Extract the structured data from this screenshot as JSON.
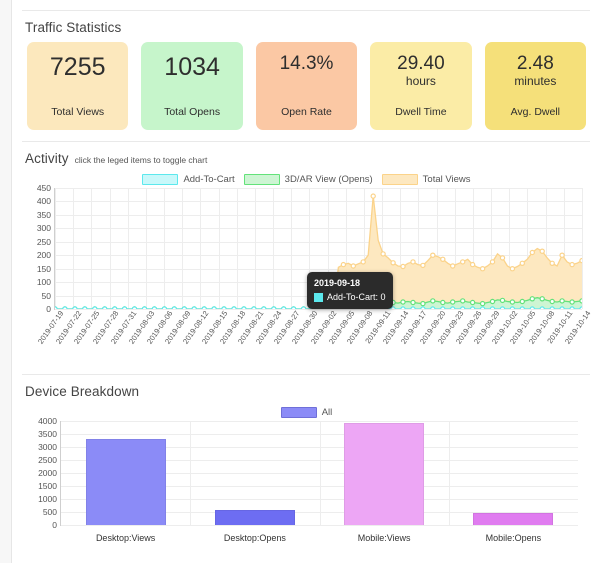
{
  "traffic": {
    "title": "Traffic Statistics",
    "cards": [
      {
        "value": "7255",
        "unit": "",
        "label": "Total Views",
        "color": "#fce8bd",
        "size": "lg"
      },
      {
        "value": "1034",
        "unit": "",
        "label": "Total Opens",
        "color": "#c6f5cb",
        "size": "lg"
      },
      {
        "value": "14.3%",
        "unit": "",
        "label": "Open Rate",
        "color": "#fbc8a4",
        "size": "sm"
      },
      {
        "value": "29.40",
        "unit": "hours",
        "label": "Dwell Time",
        "color": "#fbeca6",
        "size": "sm"
      },
      {
        "value": "2.48",
        "unit": "minutes",
        "label": "Avg. Dwell",
        "color": "#f5e07a",
        "size": "sm"
      }
    ]
  },
  "activity": {
    "title": "Activity",
    "subtitle": "click the leged items to toggle chart",
    "tooltip": {
      "date": "2019-09-18",
      "series_label": "Add-To-Cart",
      "value": "0",
      "row_text": "Add-To-Cart: 0",
      "swatch_color": "#5ce8ed"
    },
    "chart_data": {
      "type": "area",
      "title": "Activity",
      "xlabel": "",
      "ylabel": "",
      "ylim": [
        0,
        450
      ],
      "yticks": [
        0,
        50,
        100,
        150,
        200,
        250,
        300,
        350,
        400,
        450
      ],
      "grid": true,
      "legend_position": "top-center",
      "x": [
        "2019-07-19",
        "2019-07-22",
        "2019-07-25",
        "2019-07-28",
        "2019-07-31",
        "2019-08-03",
        "2019-08-06",
        "2019-08-09",
        "2019-08-12",
        "2019-08-15",
        "2019-08-18",
        "2019-08-21",
        "2019-08-24",
        "2019-08-27",
        "2019-08-30",
        "2019-09-02",
        "2019-09-05",
        "2019-09-08",
        "2019-09-11",
        "2019-09-14",
        "2019-09-17",
        "2019-09-20",
        "2019-09-23",
        "2019-09-26",
        "2019-09-29",
        "2019-10-02",
        "2019-10-05",
        "2019-10-08",
        "2019-10-11",
        "2019-10-14"
      ],
      "series": [
        {
          "name": "Total Views",
          "color": "#fbd38a",
          "fill": "#fde8c0",
          "values": [
            0,
            0,
            0,
            0,
            0,
            0,
            0,
            0,
            0,
            0,
            0,
            0,
            0,
            0,
            0,
            0,
            0,
            0,
            0,
            0,
            0,
            0,
            0,
            0,
            0,
            0,
            0,
            0,
            0,
            0,
            0,
            0,
            0,
            0,
            0,
            0,
            0,
            0,
            0,
            0,
            0,
            0,
            0,
            0,
            0,
            0,
            0,
            0,
            0,
            0,
            0,
            0,
            0,
            0,
            0,
            0,
            0,
            155,
            165,
            170,
            160,
            168,
            175,
            200,
            420,
            255,
            205,
            190,
            172,
            160,
            158,
            170,
            175,
            165,
            162,
            180,
            200,
            195,
            185,
            170,
            160,
            168,
            175,
            185,
            165,
            155,
            150,
            160,
            175,
            205,
            190,
            160,
            150,
            158,
            170,
            185,
            210,
            225,
            215,
            190,
            170,
            160,
            200,
            175,
            165,
            170,
            180
          ]
        },
        {
          "name": "3D/AR View (Opens)",
          "color": "#63e27a",
          "fill": "#cdf5d3",
          "values": [
            0,
            0,
            0,
            0,
            0,
            0,
            0,
            0,
            0,
            0,
            0,
            0,
            0,
            0,
            0,
            0,
            0,
            0,
            0,
            0,
            0,
            0,
            0,
            0,
            0,
            0,
            0,
            0,
            0,
            0,
            0,
            0,
            0,
            0,
            0,
            0,
            0,
            0,
            0,
            0,
            0,
            0,
            0,
            0,
            0,
            0,
            0,
            0,
            0,
            0,
            0,
            0,
            0,
            0,
            0,
            0,
            0,
            18,
            22,
            20,
            24,
            22,
            26,
            24,
            30,
            26,
            22,
            25,
            24,
            22,
            26,
            28,
            24,
            22,
            20,
            26,
            30,
            28,
            24,
            22,
            26,
            28,
            30,
            26,
            24,
            22,
            20,
            24,
            28,
            34,
            32,
            28,
            26,
            24,
            28,
            32,
            38,
            42,
            38,
            32,
            28,
            26,
            30,
            28,
            26,
            28,
            30
          ]
        },
        {
          "name": "Add-To-Cart",
          "color": "#5ce8ed",
          "fill": "#c8f8fa",
          "values": [
            0,
            0,
            0,
            0,
            0,
            0,
            0,
            0,
            0,
            0,
            0,
            0,
            0,
            0,
            0,
            0,
            0,
            0,
            0,
            0,
            0,
            0,
            0,
            0,
            0,
            0,
            0,
            0,
            0,
            0,
            0,
            0,
            0,
            0,
            0,
            0,
            0,
            0,
            0,
            0,
            0,
            0,
            0,
            0,
            0,
            0,
            0,
            0,
            0,
            0,
            0,
            0,
            0,
            0,
            0,
            0,
            0,
            0,
            0,
            0,
            0,
            0,
            0,
            0,
            0,
            0,
            0,
            0,
            0,
            0,
            0,
            0,
            0,
            0,
            0,
            0,
            0,
            0,
            0,
            0,
            0,
            0,
            0,
            0,
            0,
            0,
            0,
            0,
            0,
            0,
            0,
            0,
            0,
            0,
            0,
            0,
            0,
            0,
            0,
            0,
            0,
            0,
            0,
            0,
            0,
            0,
            0
          ]
        }
      ],
      "legend": [
        {
          "name": "Add-To-Cart",
          "swatch": "#c8f8fa",
          "border": "#5ce8ed"
        },
        {
          "name": "3D/AR View (Opens)",
          "swatch": "#cdf5d3",
          "border": "#63e27a"
        },
        {
          "name": "Total Views",
          "swatch": "#fde8c0",
          "border": "#fbd38a"
        }
      ]
    }
  },
  "device": {
    "title": "Device Breakdown",
    "legend": [
      {
        "name": "All",
        "swatch": "#8b8bf7",
        "border": "#6f6fd8"
      }
    ],
    "chart_data": {
      "type": "bar",
      "title": "Device Breakdown",
      "xlabel": "",
      "ylabel": "",
      "ylim": [
        0,
        4000
      ],
      "yticks": [
        0,
        500,
        1000,
        1500,
        2000,
        2500,
        3000,
        3500,
        4000
      ],
      "grid": true,
      "legend_position": "top-center",
      "categories": [
        "Desktop:Views",
        "Desktop:Opens",
        "Mobile:Views",
        "Mobile:Opens"
      ],
      "values": [
        3320,
        560,
        3935,
        475
      ],
      "colors": [
        "#8b8bf7",
        "#6d6df2",
        "#eda6f5",
        "#e07cf0"
      ]
    }
  }
}
